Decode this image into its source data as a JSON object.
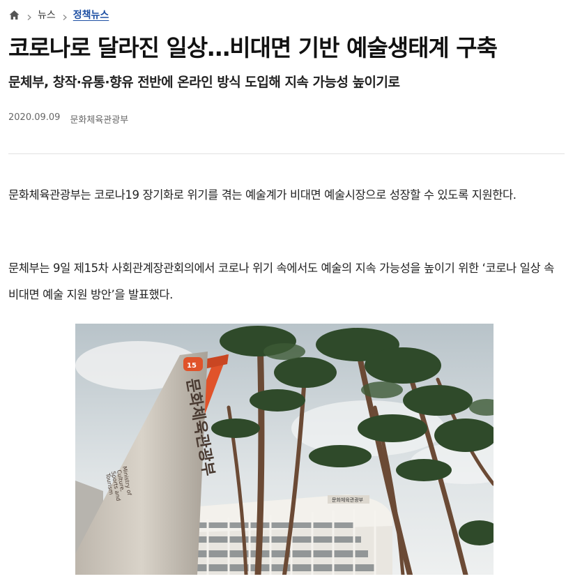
{
  "breadcrumb": {
    "home_icon": "home-icon",
    "items": [
      "뉴스",
      "정책뉴스"
    ]
  },
  "article": {
    "title": "코로나로 달라진 일상…비대면 기반 예술생태계 구축",
    "subtitle": "문체부, 창작·유통·향유 전반에 온라인 방식 도입해 지속 가능성 높이기로",
    "date": "2020.09.09",
    "source": "문화체육관광부",
    "paragraphs": [
      "문화체육관광부는 코로나19 장기화로 위기를 겪는 예술계가 비대면 예술시장으로 성장할 수 있도록 지원한다.",
      "문체부는 9일 제15차 사회관계장관회의에서 코로나 위기 속에서도 예술의 지속 가능성을 높이기 위한 ‘코로나 일상 속 비대면 예술 지원 방안’을 발표했다."
    ]
  },
  "photo": {
    "sign_badge": "15",
    "sign_korean": "문화체육관광부",
    "sign_english": [
      "Ministry of",
      "Culture,",
      "Sports and",
      "Tourism"
    ],
    "building_sign": "문화체육관광부"
  },
  "colors": {
    "accent_link": "#1d4fa3",
    "sign_orange": "#e0532a"
  }
}
